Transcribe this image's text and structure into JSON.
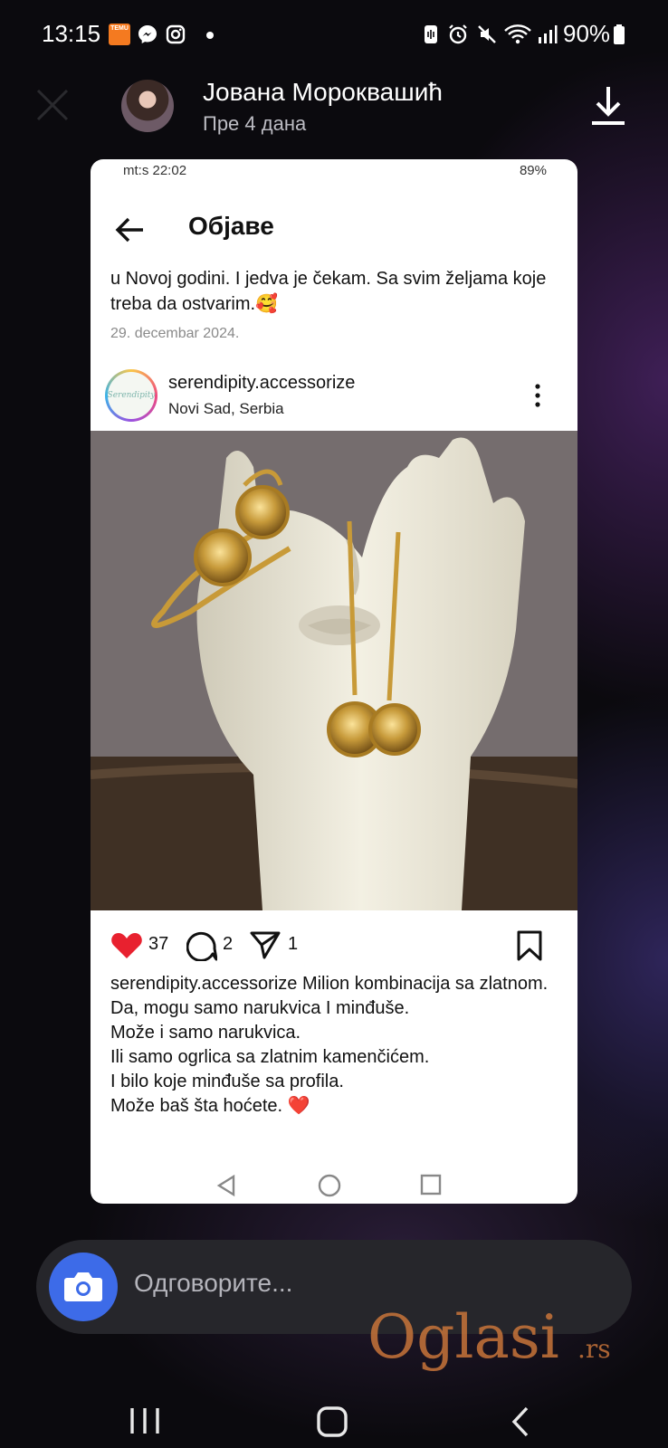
{
  "status": {
    "time": "13:15",
    "battery": "90%"
  },
  "viewer": {
    "user_name": "Јована Мороквашић",
    "posted": "Пре 4 дана"
  },
  "inner": {
    "status_left": "mt:s 22:02",
    "status_battery": "89%",
    "title": "Објаве",
    "previous_caption": "u Novoj godini. I jedva je čekam. Sa svim željama koje treba da ostvarim.🥰",
    "previous_date": "29. decembar 2024.",
    "account": {
      "name": "serendipity.accessorize",
      "location": "Novi Sad, Serbia",
      "logo_text": "Serendipity"
    },
    "likes": "37",
    "comments": "2",
    "shares": "1",
    "caption_user": "serendipity.accessorize",
    "caption_lines": [
      " Milion kombinacija sa zlatnom.",
      "Da, mogu samo narukvica I minđuše.",
      "Može i samo narukvica.",
      "Ili samo ogrlica sa zlatnim kamenčićem.",
      "I bilo koje minđuše sa profila.",
      "Može baš šta hoćete. ❤️"
    ]
  },
  "reply": {
    "placeholder": "Одговорите..."
  },
  "watermark": {
    "brand": "Oglasi",
    "tld": ".rs"
  },
  "colors": {
    "like": "#e8212f",
    "camera": "#3d6be8",
    "watermark": "#c8743a"
  }
}
